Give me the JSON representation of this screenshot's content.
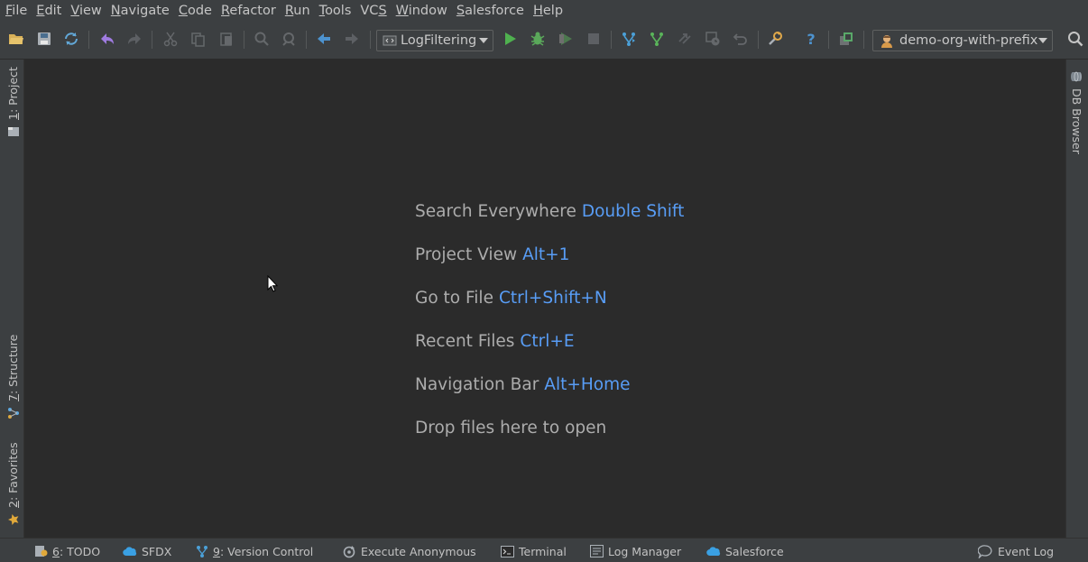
{
  "menu": [
    {
      "label": "File",
      "mnemonic": "F",
      "rest": "ile"
    },
    {
      "label": "Edit",
      "mnemonic": "E",
      "rest": "dit"
    },
    {
      "label": "View",
      "mnemonic": "V",
      "rest": "iew"
    },
    {
      "label": "Navigate",
      "mnemonic": "N",
      "rest": "avigate"
    },
    {
      "label": "Code",
      "mnemonic": "C",
      "rest": "ode"
    },
    {
      "label": "Refactor",
      "mnemonic": "R",
      "rest": "efactor"
    },
    {
      "label": "Run",
      "mnemonic": "R",
      "rest": "un"
    },
    {
      "label": "Tools",
      "mnemonic": "T",
      "rest": "ools"
    },
    {
      "label": "VCS",
      "mnemonic": "S",
      "rest": ""
    },
    {
      "label": "Window",
      "mnemonic": "W",
      "rest": "indow"
    },
    {
      "label": "Salesforce",
      "mnemonic": "S",
      "rest": "alesforce"
    },
    {
      "label": "Help",
      "mnemonic": "H",
      "rest": "elp"
    }
  ],
  "toolbar": {
    "run_config": "LogFiltering",
    "org_selector": "demo-org-with-prefix"
  },
  "left_stripe": {
    "project": {
      "num": "1",
      "label": ": Project"
    },
    "structure": {
      "num": "7",
      "label": ": Structure"
    },
    "favorites": {
      "num": "2",
      "label": ": Favorites"
    }
  },
  "right_stripe": {
    "db_browser": "DB Browser"
  },
  "hints": [
    {
      "label": "Search Everywhere",
      "shortcut": "Double Shift"
    },
    {
      "label": "Project View",
      "shortcut": "Alt+1"
    },
    {
      "label": "Go to File",
      "shortcut": "Ctrl+Shift+N"
    },
    {
      "label": "Recent Files",
      "shortcut": "Ctrl+E"
    },
    {
      "label": "Navigation Bar",
      "shortcut": "Alt+Home"
    },
    {
      "label": "Drop files here to open",
      "shortcut": ""
    }
  ],
  "bottom_tabs": {
    "todo": {
      "num": "6",
      "label": ": TODO"
    },
    "sfdx": "SFDX",
    "vcs": {
      "num": "9",
      "label": ": Version Control"
    },
    "execute": "Execute Anonymous",
    "terminal": "Terminal",
    "log_manager": "Log Manager",
    "salesforce": "Salesforce",
    "event_log": "Event Log"
  },
  "colors": {
    "background": "#2b2b2b",
    "panel": "#3c3f41",
    "shortcut": "#589df6",
    "hint_text": "#acacac"
  }
}
